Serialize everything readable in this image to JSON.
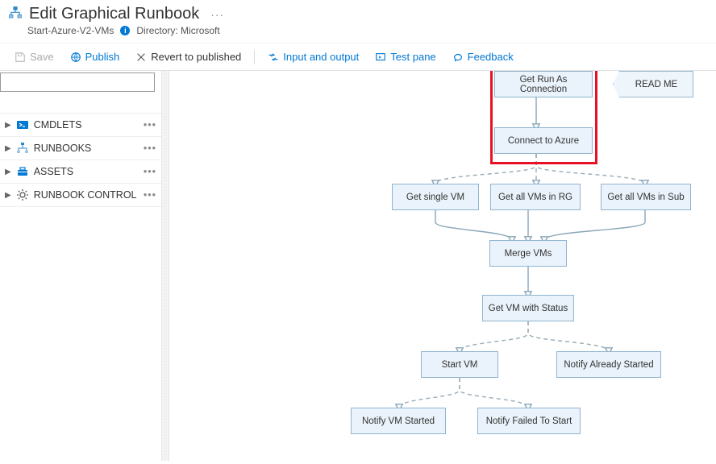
{
  "header": {
    "title": "Edit Graphical Runbook",
    "runbook_name": "Start-Azure-V2-VMs",
    "directory_label": "Directory: Microsoft",
    "ellipsis": "···"
  },
  "toolbar": {
    "save": "Save",
    "publish": "Publish",
    "revert": "Revert to published",
    "io": "Input and output",
    "testpane": "Test pane",
    "feedback": "Feedback"
  },
  "sidebar": {
    "search_placeholder": "",
    "items": [
      {
        "label": "CMDLETS",
        "icon": "powershell-icon",
        "color": "#0078d4"
      },
      {
        "label": "RUNBOOKS",
        "icon": "hierarchy-icon",
        "color": "#0078d4"
      },
      {
        "label": "ASSETS",
        "icon": "toolbox-icon",
        "color": "#0078d4"
      },
      {
        "label": "RUNBOOK CONTROL",
        "icon": "gear-icon",
        "color": "#555"
      }
    ],
    "dots": "•••"
  },
  "canvas": {
    "nodes": {
      "get_conn": "Get Run As Connection",
      "connect_azure": "Connect to Azure",
      "readme": "READ ME",
      "get_single": "Get single VM",
      "get_rg": "Get all VMs in RG",
      "get_sub": "Get all VMs in Sub",
      "merge": "Merge VMs",
      "get_status": "Get VM with Status",
      "start_vm": "Start VM",
      "notify_already": "Notify Already Started",
      "notify_started": "Notify VM Started",
      "notify_failed": "Notify Failed To Start"
    }
  }
}
